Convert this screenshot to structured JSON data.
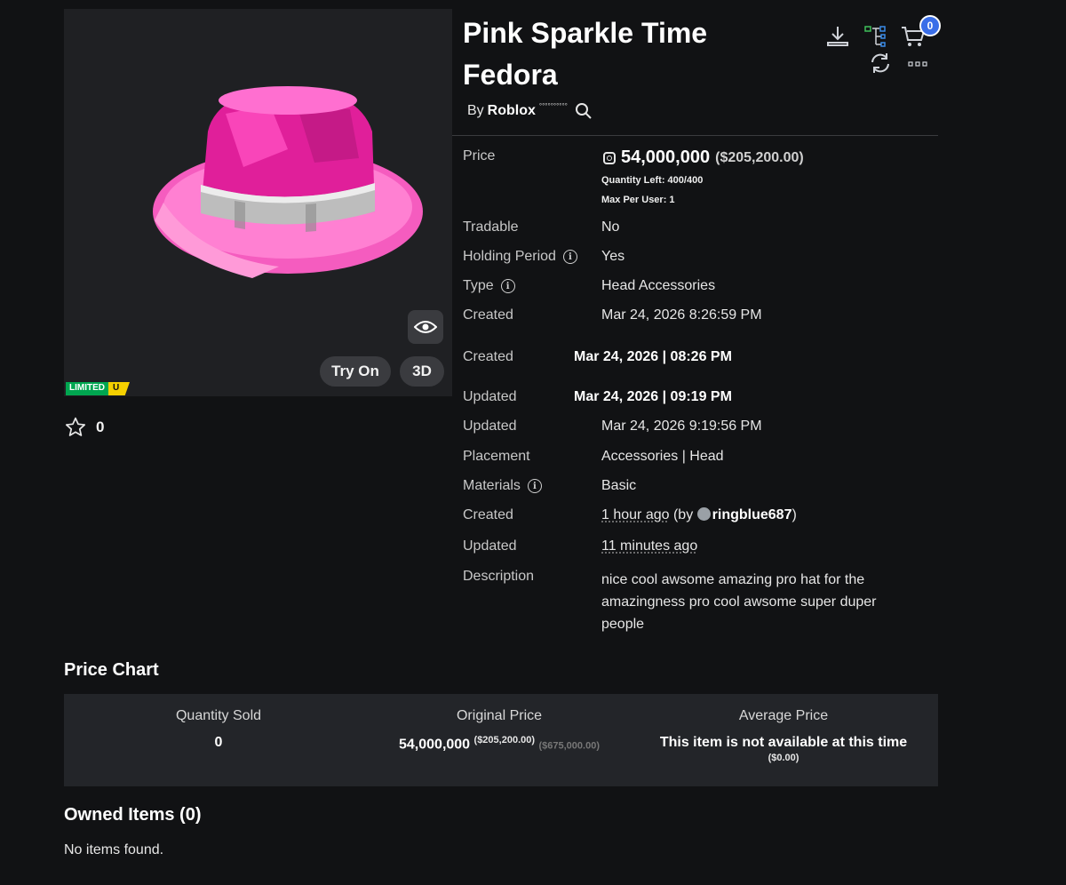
{
  "item": {
    "title": "Pink Sparkle Time Fedora",
    "by_label": "By",
    "creator": "Roblox",
    "creator_suffix": "°°°°°°°°°°",
    "limited_badge": "LIMITED",
    "limited_u": "U",
    "favorites": "0",
    "try_on_label": "Try On",
    "view_3d_label": "3D",
    "cart_count": "0"
  },
  "price": {
    "label": "Price",
    "robux": "54,000,000",
    "usd": "($205,200.00)",
    "quantity_left": "Quantity Left: 400/400",
    "max_per_user": "Max Per User: 1"
  },
  "details": [
    {
      "label": "Tradable",
      "value": "No"
    },
    {
      "label": "Holding Period",
      "value": "Yes"
    },
    {
      "label": "Type",
      "value": "Head Accessories"
    },
    {
      "label": "Created",
      "value": "Mar 24, 2026 8:26:59 PM"
    },
    {
      "label": "Created",
      "value": "Mar 24, 2026 | 08:26 PM"
    },
    {
      "label": "Updated",
      "value": "Mar 24, 2026 | 09:19 PM"
    },
    {
      "label": "Updated",
      "value": "Mar 24, 2026 9:19:56 PM"
    },
    {
      "label": "Placement",
      "value": "Accessories | Head"
    },
    {
      "label": "Materials",
      "value": "Basic"
    },
    {
      "label": "Created",
      "value": "1 hour ago",
      "by_prefix": "(by",
      "by_user": "ringblue687",
      "by_suffix": ")"
    },
    {
      "label": "Updated",
      "value": "11 minutes ago"
    },
    {
      "label": "Description",
      "value": "nice cool awsome amazing pro hat for the amazingness  pro cool awsome super duper people"
    }
  ],
  "price_chart": {
    "heading": "Price Chart",
    "quantity_sold_label": "Quantity Sold",
    "quantity_sold": "0",
    "original_price_label": "Original Price",
    "original_price": "54,000,000",
    "original_usd": "($205,200.00)",
    "original_alt": "($675,000.00)",
    "average_price_label": "Average Price",
    "average_price": "This item is not available at this time",
    "average_usd": "($0.00)"
  },
  "owned": {
    "heading": "Owned Items (0)",
    "empty": "No items found."
  },
  "colors": {
    "background": "#111214",
    "panel": "#1f2023",
    "hat_pink": "#ff3fb4",
    "badge_blue": "#3a6ee8",
    "limited_green": "#00a650",
    "limited_yellow": "#f5d000"
  }
}
